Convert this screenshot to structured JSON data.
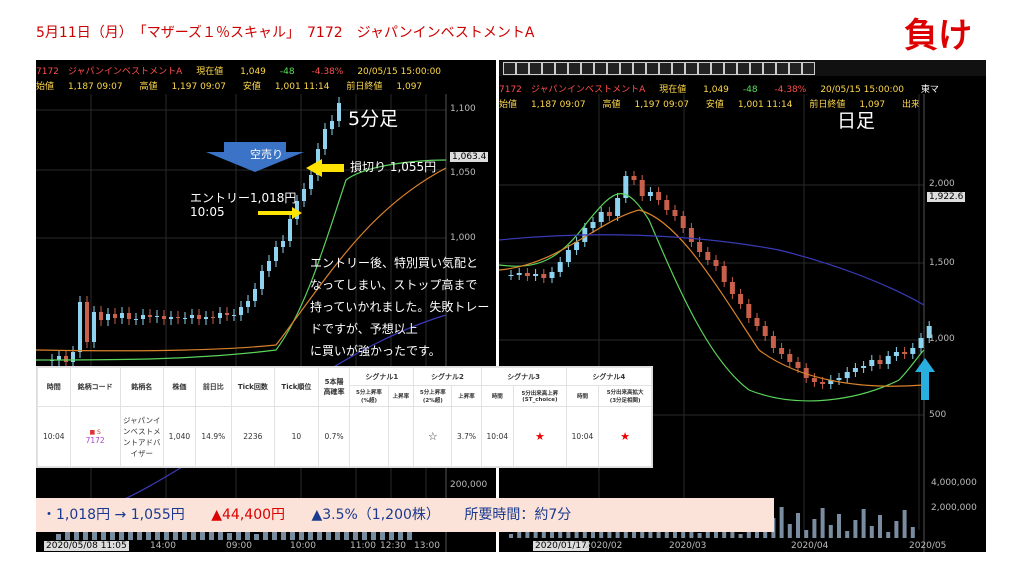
{
  "header": {
    "text": "5月11日（月）　「マザーズ１％スキャル」　7172　ジャパンインベストメントA"
  },
  "result": "負け",
  "left_chart": {
    "info1": [
      "7172　ジャパンインベストメントA",
      "現在値",
      "1,049",
      "-48",
      "-4.38%",
      "20/05/15 15:00:00"
    ],
    "info2": [
      "始値",
      "1,187 09:07",
      "高値",
      "1,197 09:07",
      "安値",
      "1,001 11:14",
      "前日終値",
      "1,097"
    ],
    "title": "5分足",
    "yaxis": [
      "1,100",
      "1,063.4",
      "1,050",
      "1,000",
      "200,000"
    ],
    "xaxis": [
      "2020/05/08 11:05",
      "14:00",
      "09:00",
      "10:00",
      "11:00",
      "12:30",
      "13:00"
    ],
    "callouts": {
      "short": "空売り",
      "stoploss": "損切り 1,055円",
      "entry": "エントリー1,018円\n10:05"
    },
    "annotation": [
      "エントリー後、特別買い気配と",
      "なってしまい、ストップ高まで",
      "持っていかれました。失敗トレードですが、予想以上",
      "に買いが強かったです。"
    ]
  },
  "right_chart": {
    "info1": [
      "7172　ジャパンインベストメントA",
      "現在値",
      "1,049",
      "-48",
      "-4.38%",
      "20/05/15 15:00:00",
      "東マ"
    ],
    "info2": [
      "始値",
      "1,187 09:07",
      "高値",
      "1,197 09:07",
      "安値",
      "1,001 11:14",
      "前日終値",
      "1,097",
      "出来"
    ],
    "title": "日足",
    "yaxis": [
      "2,000",
      "1,922.6",
      "1,500",
      "1,000",
      "500",
      "4,000,000",
      "2,000,000"
    ],
    "xaxis": [
      "2020/01/17",
      "2020/02",
      "2020/03",
      "2020/04",
      "2020/05"
    ]
  },
  "signal_table": {
    "headers": [
      "時間",
      "銘柄コード",
      "銘柄名",
      "株価",
      "前日比",
      "Tick回数",
      "Tick順位",
      "5本陽\n高確率",
      "シグナル1",
      "シグナル2",
      "シグナル3",
      "シグナル4"
    ],
    "subheaders": [
      "5分上昇率\n(%超)",
      "上昇率",
      "5分上昇率\n(2%超)",
      "上昇率",
      "時間",
      "5分出来高上昇\n(ST_choice)",
      "時間",
      "5分出来高拡大\n(3分足相関)"
    ],
    "row": [
      "10:04",
      "7172",
      "ジャパンインベストメントアドバイザー",
      "1,040",
      "14.9%",
      "2236",
      "10",
      "0.7%",
      "",
      "",
      "☆",
      "3.7%",
      "10:04",
      "★",
      "10:04",
      "★"
    ],
    "code_badge": "■ S"
  },
  "summary": {
    "trade": "・1,018円 → 1,055円",
    "loss": "▲44,400円",
    "pct": "▲3.5%（1,200株）",
    "time": "所要時間：約7分"
  },
  "colors": {
    "bull": "#8ed4f0",
    "bear": "#c9604b",
    "ma_short": "#5bd35b",
    "ma_mid": "#d9822b",
    "ma_long": "#3a3ab8"
  }
}
